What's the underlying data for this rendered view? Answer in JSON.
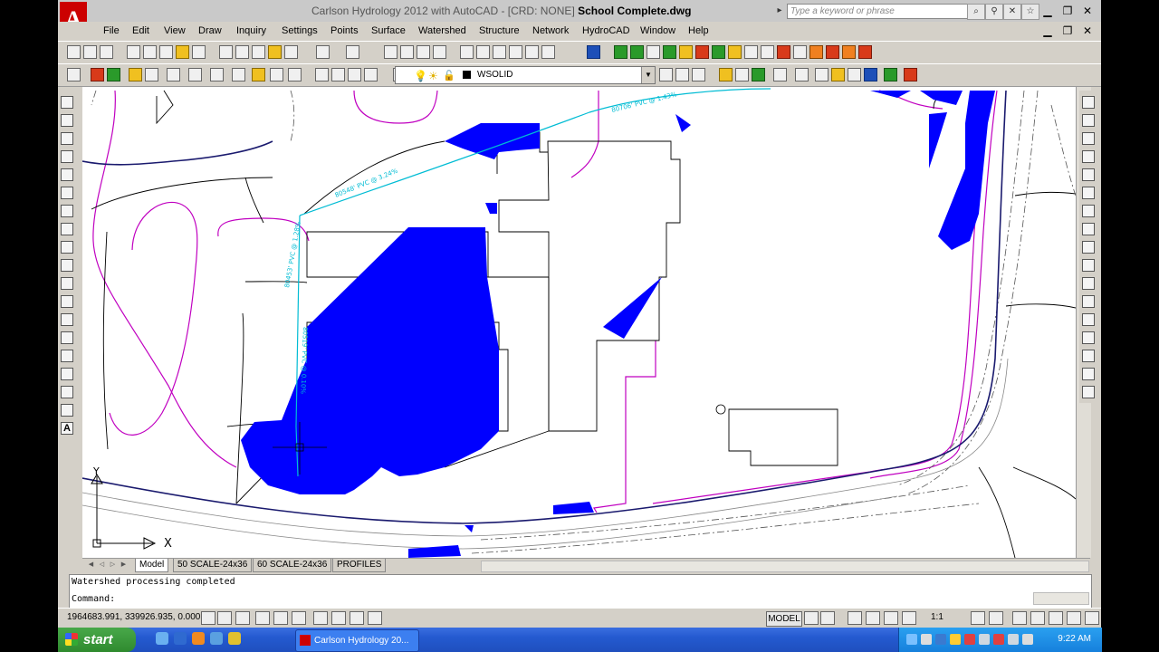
{
  "window": {
    "app_name": "Carlson Hydrology 2012 with AutoCAD - [CRD: NONE]",
    "file_name": "School Complete.dwg",
    "search_placeholder": "Type a keyword or phrase",
    "logo_letter": "A"
  },
  "menu": [
    "File",
    "Edit",
    "View",
    "Draw",
    "Inquiry",
    "Settings",
    "Points",
    "Surface",
    "Watershed",
    "Structure",
    "Network",
    "HydroCAD",
    "Window",
    "Help"
  ],
  "layer": {
    "current": "WSOLID",
    "color": "#000000"
  },
  "canvas": {
    "pipe_labels": [
      "80706' PVC @ 1.43%",
      "80548' PVC @ 3.24%",
      "80453' PVC @ 1.28%",
      "80519' PVC @ 0.10%"
    ],
    "ucs_labels": {
      "x": "X",
      "y": "Y"
    },
    "colors": {
      "fill": "#0000ff",
      "boundary": "#c000c0",
      "pipe": "#00bcd4",
      "road": "#1a1a6e",
      "line": "#000000"
    }
  },
  "tabs": [
    "Model",
    "50 SCALE-24x36",
    "60 SCALE-24x36",
    "PROFILES"
  ],
  "command": {
    "history": "Watershed processing completed",
    "prompt": "Command:"
  },
  "status": {
    "coords": "1964683.991, 339926.935, 0.000",
    "model": "MODEL",
    "scale": "1:1"
  },
  "taskbar": {
    "start": "start",
    "task": "Carlson Hydrology 20...",
    "time": "9:22 AM"
  }
}
